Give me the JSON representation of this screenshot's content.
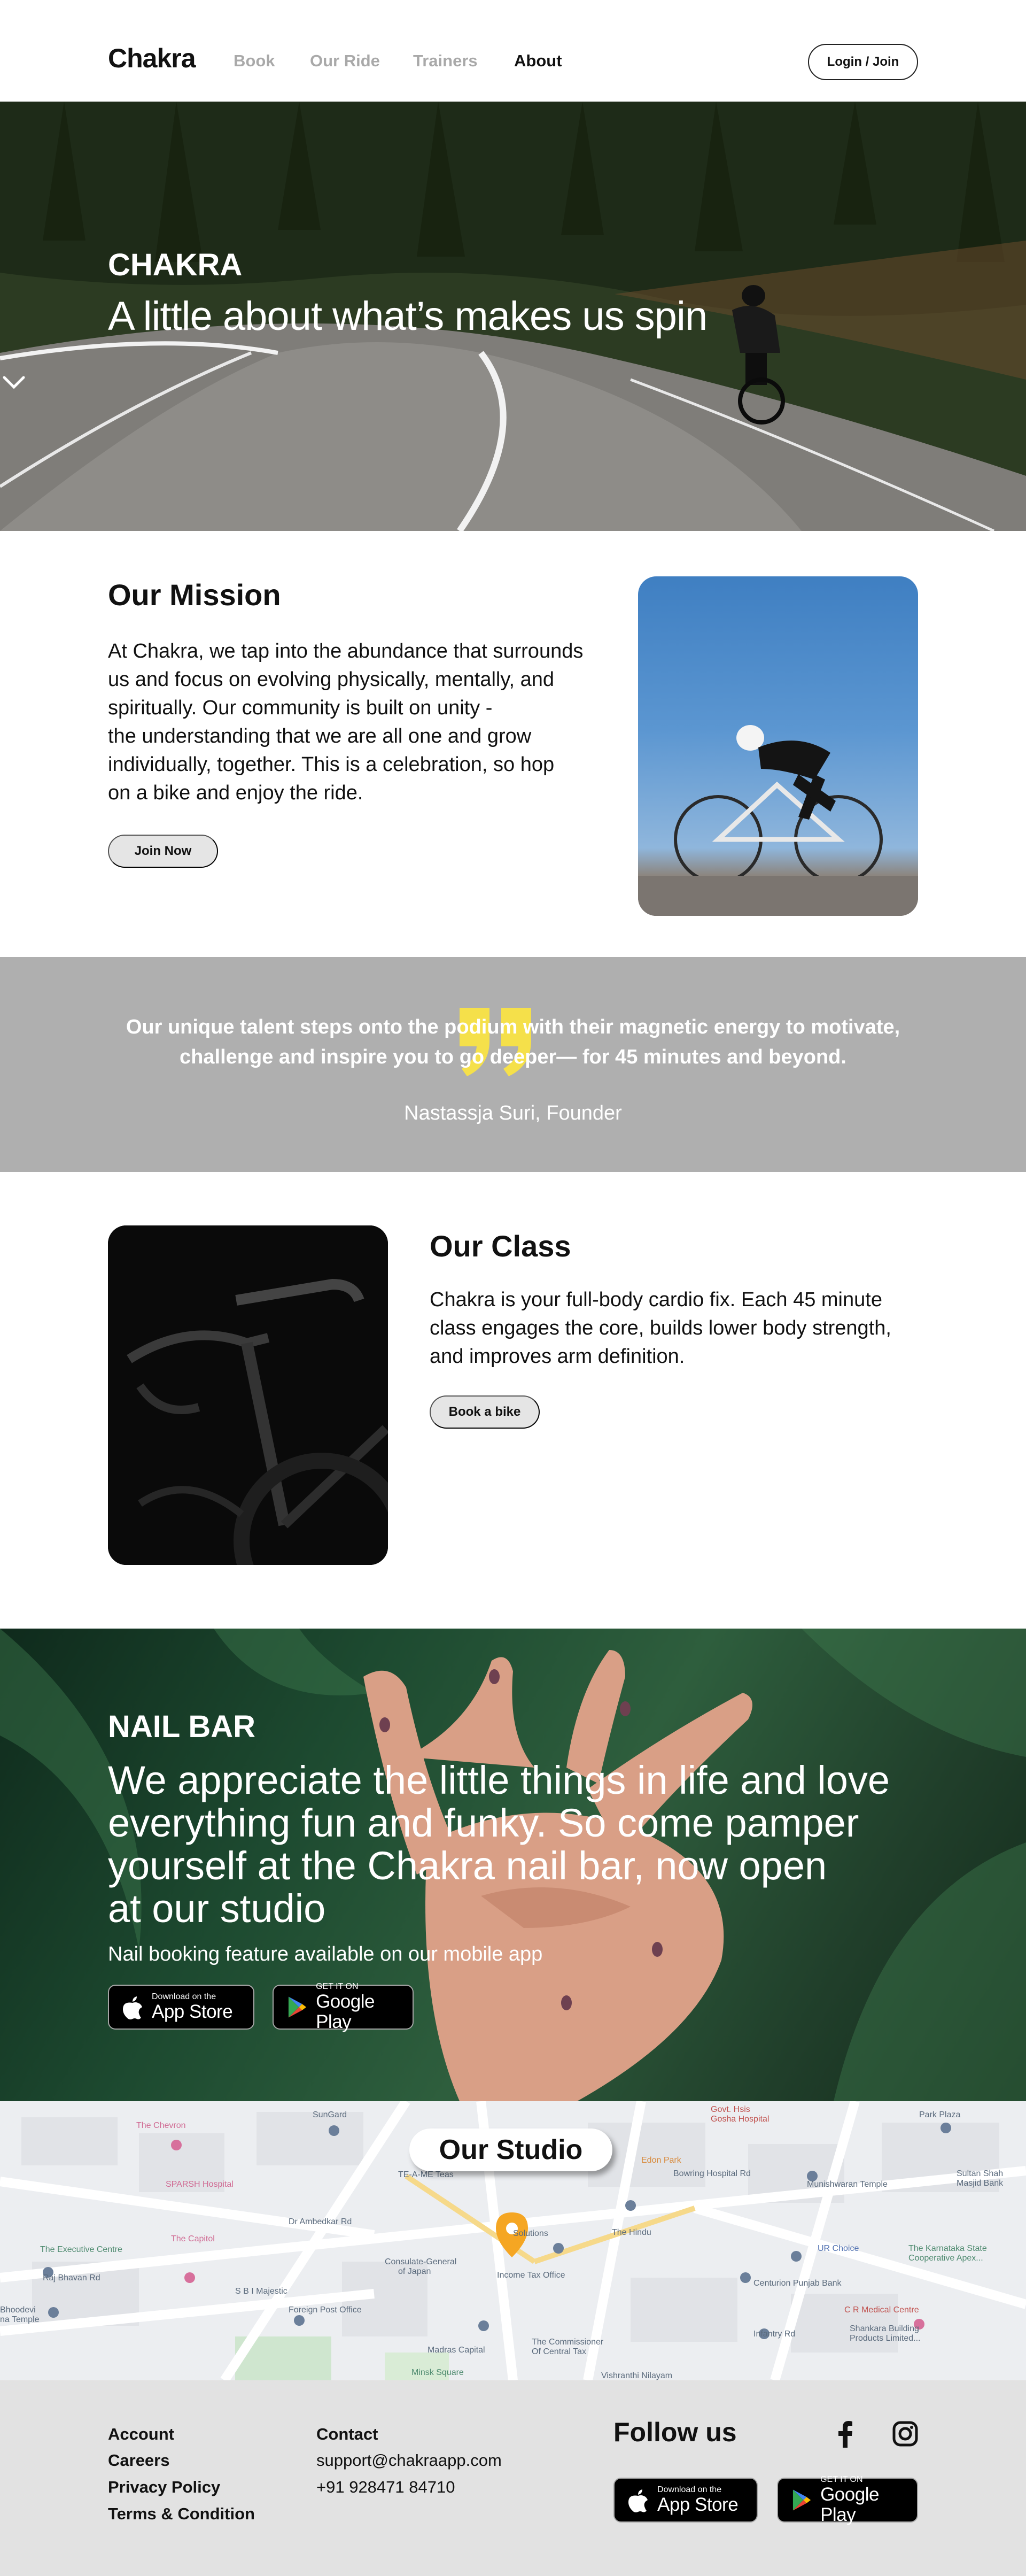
{
  "nav": {
    "logo": "Chakra",
    "links": [
      {
        "label": "Book"
      },
      {
        "label": "Our Ride"
      },
      {
        "label": "Trainers"
      },
      {
        "label": "About"
      }
    ],
    "active": "About",
    "login_label": "Login / Join"
  },
  "hero": {
    "eyebrow": "CHAKRA",
    "title": "A little about what’s makes us spin"
  },
  "mission": {
    "title": "Our Mission",
    "lines": [
      "At Chakra, we tap into the abundance that surrounds",
      "us and focus on evolving physically, mentally, and",
      "spiritually. Our community is built on unity -",
      "the understanding that we are all one and grow",
      "individually, together. This is a celebration, so hop",
      "on a bike and enjoy the ride."
    ],
    "button": "Join Now"
  },
  "quote": {
    "lines": [
      "Our unique talent steps onto the podium with their magnetic energy to motivate,",
      "challenge and inspire you to go deeper— for 45 minutes and beyond."
    ],
    "author": "Nastassja Suri, Founder",
    "accent": "#f5e04a"
  },
  "class_section": {
    "title": "Our Class",
    "lines": [
      "Chakra is your full-body cardio fix. Each 45 minute",
      "class engages the core, builds lower body strength,",
      "and improves arm definition."
    ],
    "button": "Book a bike"
  },
  "nail_bar": {
    "eyebrow": "NAIL BAR",
    "lines": [
      "We appreciate the little things in life and love",
      "everything fun and funky.  So come pamper",
      "yourself at  the Chakra nail bar, now open",
      "at our studio"
    ],
    "note": "Nail booking feature available on our mobile app",
    "app_store": {
      "small": "Download on the",
      "big": "App Store"
    },
    "google_play": {
      "small": "GET IT ON",
      "big": "Google Play"
    }
  },
  "map": {
    "label": "Our Studio",
    "places": [
      "SunGard",
      "Govt. Hsis",
      "Gosha Hospital",
      "Park Plaza",
      "The Chevron",
      "TE-A-ME Teas",
      "Edon Park",
      "Munishwaran Temple",
      "Sultan Shah",
      "Masjid Bank",
      "SPARSH Hospital",
      "Bowring Hospital Rd",
      "The Executive Centre",
      "The Capitol",
      "Solutions",
      "The Hindu",
      "Consulate-General",
      "of Japan",
      "Income Tax Office",
      "UR Choice",
      "The Karnataka State",
      "Cooperative Apex...",
      "Centurion Punjab Bank",
      "Raj Bhavan Rd",
      "S B I Majestic",
      "Foreign Post Office",
      "The Commissioner",
      "Of Central Tax",
      "C R Medical Centre",
      "Shankara Building",
      "Products Limited...",
      "Bhoodevi",
      "na Temple",
      "Minsk Square",
      "Vishranthi Nilayam",
      "Infantry Rd",
      "Dr Ambedkar Rd",
      "Madras Capital"
    ]
  },
  "footer": {
    "col1": [
      "Account",
      "Careers",
      "Privacy Policy",
      "Terms & Condition"
    ],
    "contact_title": "Contact",
    "email": "support@chakraapp.com",
    "phone": "+91 928471 84710",
    "follow": "Follow us",
    "social_icons": [
      "facebook-icon",
      "instagram-icon"
    ]
  },
  "colors": {
    "quote_band": "#afafaf",
    "footer_bg": "#e2e2e2",
    "pill_button": "#e5e5e5",
    "map_pin": "#f5a623"
  }
}
